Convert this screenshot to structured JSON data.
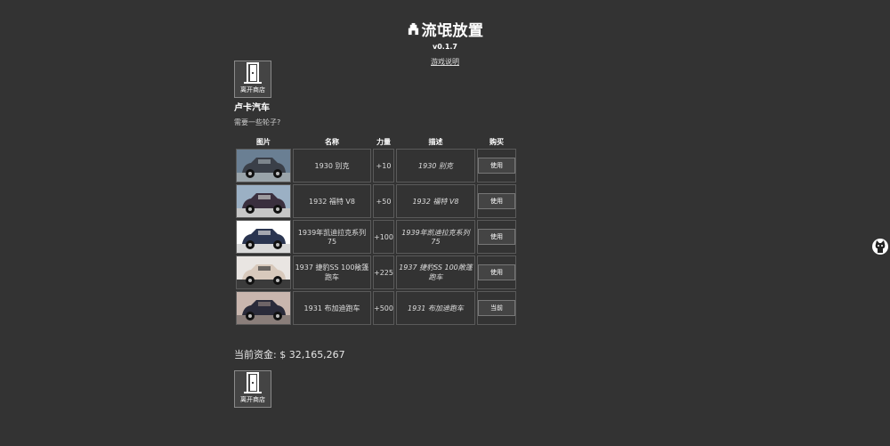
{
  "header": {
    "title": "流氓放置",
    "version": "v0.1.7",
    "help_link": "游戏说明"
  },
  "shop": {
    "leave_label": "离开商店",
    "name": "卢卡汽车",
    "description": "需要一些轮子?",
    "columns": {
      "image": "图片",
      "name": "名称",
      "power": "力量",
      "desc": "描述",
      "buy": "购买"
    },
    "items": [
      {
        "name": "1930 别克",
        "power": "+10",
        "desc": "1930 别克",
        "button": "使用",
        "palette": [
          "#6a7f93",
          "#3a3f48",
          "#9aa4aa"
        ]
      },
      {
        "name": "1932 福特 V8",
        "power": "+50",
        "desc": "1932 福特 V8",
        "button": "使用",
        "palette": [
          "#9bb0c4",
          "#3a2f3e",
          "#c7c7c7"
        ]
      },
      {
        "name": "1939年凯迪拉克系列 75",
        "power": "+100",
        "desc": "1939年凯迪拉克系列 75",
        "button": "使用",
        "palette": [
          "#ffffff",
          "#2a3550",
          "#d9d9d9"
        ]
      },
      {
        "name": "1937 捷豹SS 100敞篷跑车",
        "power": "+225",
        "desc": "1937 捷豹SS 100敞篷跑车",
        "button": "使用",
        "palette": [
          "#e9e5e2",
          "#d8c9bc",
          "#3b3b3b"
        ]
      },
      {
        "name": "1931 布加迪跑车",
        "power": "+500",
        "desc": "1931 布加迪跑车",
        "button": "当前",
        "palette": [
          "#c9b6ae",
          "#2a2b3a",
          "#8a7e7a"
        ]
      }
    ]
  },
  "funds": {
    "label": "当前资金: $ 32,165,267"
  },
  "colors": {
    "background": "#333333",
    "button_bg": "#444444",
    "border": "#5a5a5a"
  }
}
